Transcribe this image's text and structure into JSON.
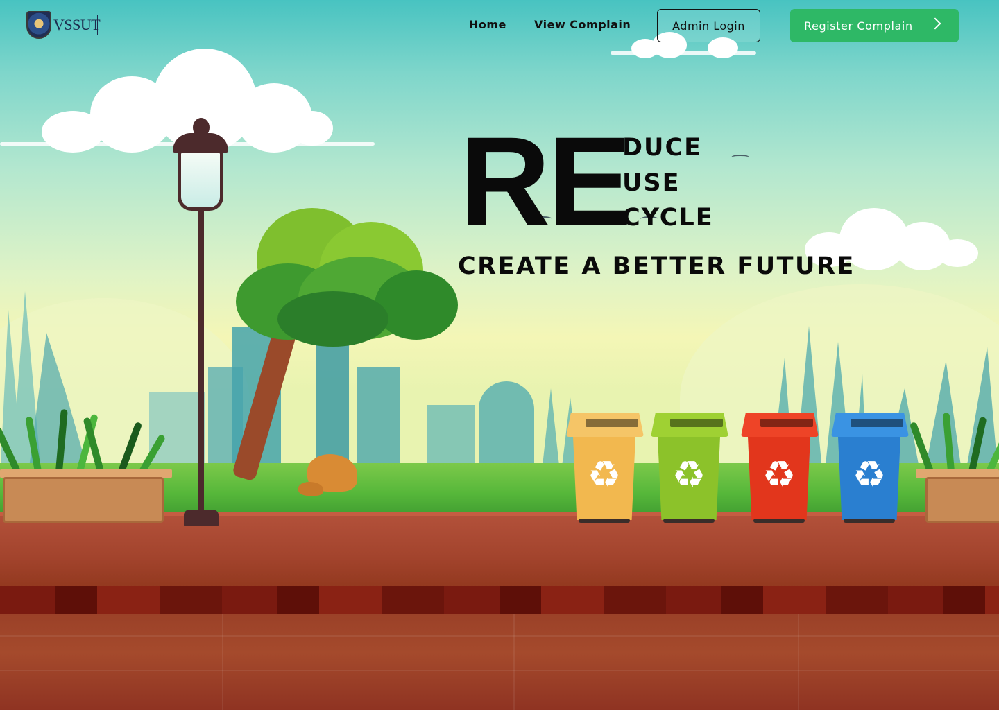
{
  "brand": {
    "logo_text": "VSSUT",
    "logo_icon": "university-emblem-icon"
  },
  "nav": {
    "home_label": "Home",
    "view_complain_label": "View Complain",
    "admin_login_label": "Admin Login",
    "register_complain_label": "Register Complain",
    "register_icon": "chevron-right-icon"
  },
  "hero": {
    "prefix": "RE",
    "words": [
      "DUCE",
      "USE",
      "CYCLE"
    ],
    "tagline": "CREATE A BETTER FUTURE"
  },
  "scene": {
    "bins": [
      {
        "color": "#f2b84f",
        "lid": "#f5c567",
        "icon": "recycle-icon"
      },
      {
        "color": "#8cc22a",
        "lid": "#9fd133",
        "icon": "recycle-icon"
      },
      {
        "color": "#e2361c",
        "lid": "#ee4427",
        "icon": "recycle-icon"
      },
      {
        "color": "#2a7fd0",
        "lid": "#3a93e3",
        "icon": "recycle-icon"
      }
    ],
    "accent": "#2eb866"
  }
}
